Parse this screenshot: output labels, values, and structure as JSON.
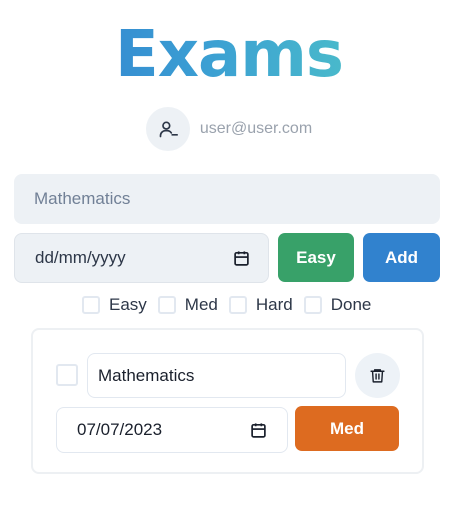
{
  "header": {
    "title": "Exams"
  },
  "user": {
    "email": "user@user.com",
    "avatar_icon": "user-minus-icon"
  },
  "form": {
    "subject_placeholder": "Mathematics",
    "date_placeholder": "dd/mm/yyyy",
    "difficulty_label": "Easy",
    "add_label": "Add"
  },
  "filters": [
    {
      "label": "Easy",
      "checked": false
    },
    {
      "label": "Med",
      "checked": false
    },
    {
      "label": "Hard",
      "checked": false
    },
    {
      "label": "Done",
      "checked": false
    }
  ],
  "exams": [
    {
      "subject": "Mathematics",
      "date": "07/07/2023",
      "difficulty": "Med",
      "done": false
    }
  ],
  "colors": {
    "easy": "#38a169",
    "add": "#3182ce",
    "med": "#dd6b20",
    "title_gradient_start": "#2f7ad0",
    "title_gradient_end": "#55cfc4"
  }
}
